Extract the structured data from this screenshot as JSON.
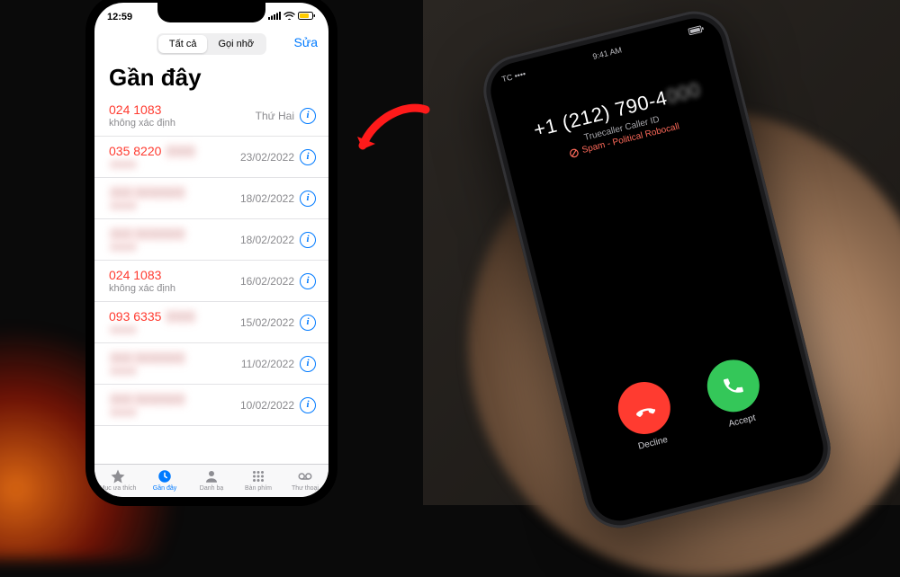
{
  "left_phone": {
    "status_time": "12:59",
    "segmented": {
      "all": "Tất cả",
      "missed": "Gọi nhỡ"
    },
    "edit": "Sửa",
    "heading": "Gần đây",
    "rows": [
      {
        "number": "024 1083",
        "sub": "không xác định",
        "date": "Thứ Hai",
        "missed": true,
        "blurred": false
      },
      {
        "number": "035 8220",
        "sub": "",
        "date": "23/02/2022",
        "missed": true,
        "blurred": true
      },
      {
        "number": "",
        "sub": "",
        "date": "18/02/2022",
        "missed": false,
        "blurred": true
      },
      {
        "number": "",
        "sub": "",
        "date": "18/02/2022",
        "missed": false,
        "blurred": true
      },
      {
        "number": "024 1083",
        "sub": "không xác định",
        "date": "16/02/2022",
        "missed": true,
        "blurred": false
      },
      {
        "number": "093 6335",
        "sub": "",
        "date": "15/02/2022",
        "missed": true,
        "blurred": true
      },
      {
        "number": "",
        "sub": "",
        "date": "11/02/2022",
        "missed": false,
        "blurred": true
      },
      {
        "number": "",
        "sub": "",
        "date": "10/02/2022",
        "missed": false,
        "blurred": true
      }
    ],
    "tabs": {
      "favorites": "Mục ưa thích",
      "recents": "Gần đây",
      "contacts": "Danh bạ",
      "keypad": "Bàn phím",
      "voicemail": "Thư thoại"
    }
  },
  "right_phone": {
    "carrier": "TC",
    "time": "9:41 AM",
    "number": "+1 (212) 790-4",
    "caller_id": "Truecaller Caller ID",
    "spam": "Spam - Political Robocall",
    "decline": "Decline",
    "accept": "Accept"
  }
}
